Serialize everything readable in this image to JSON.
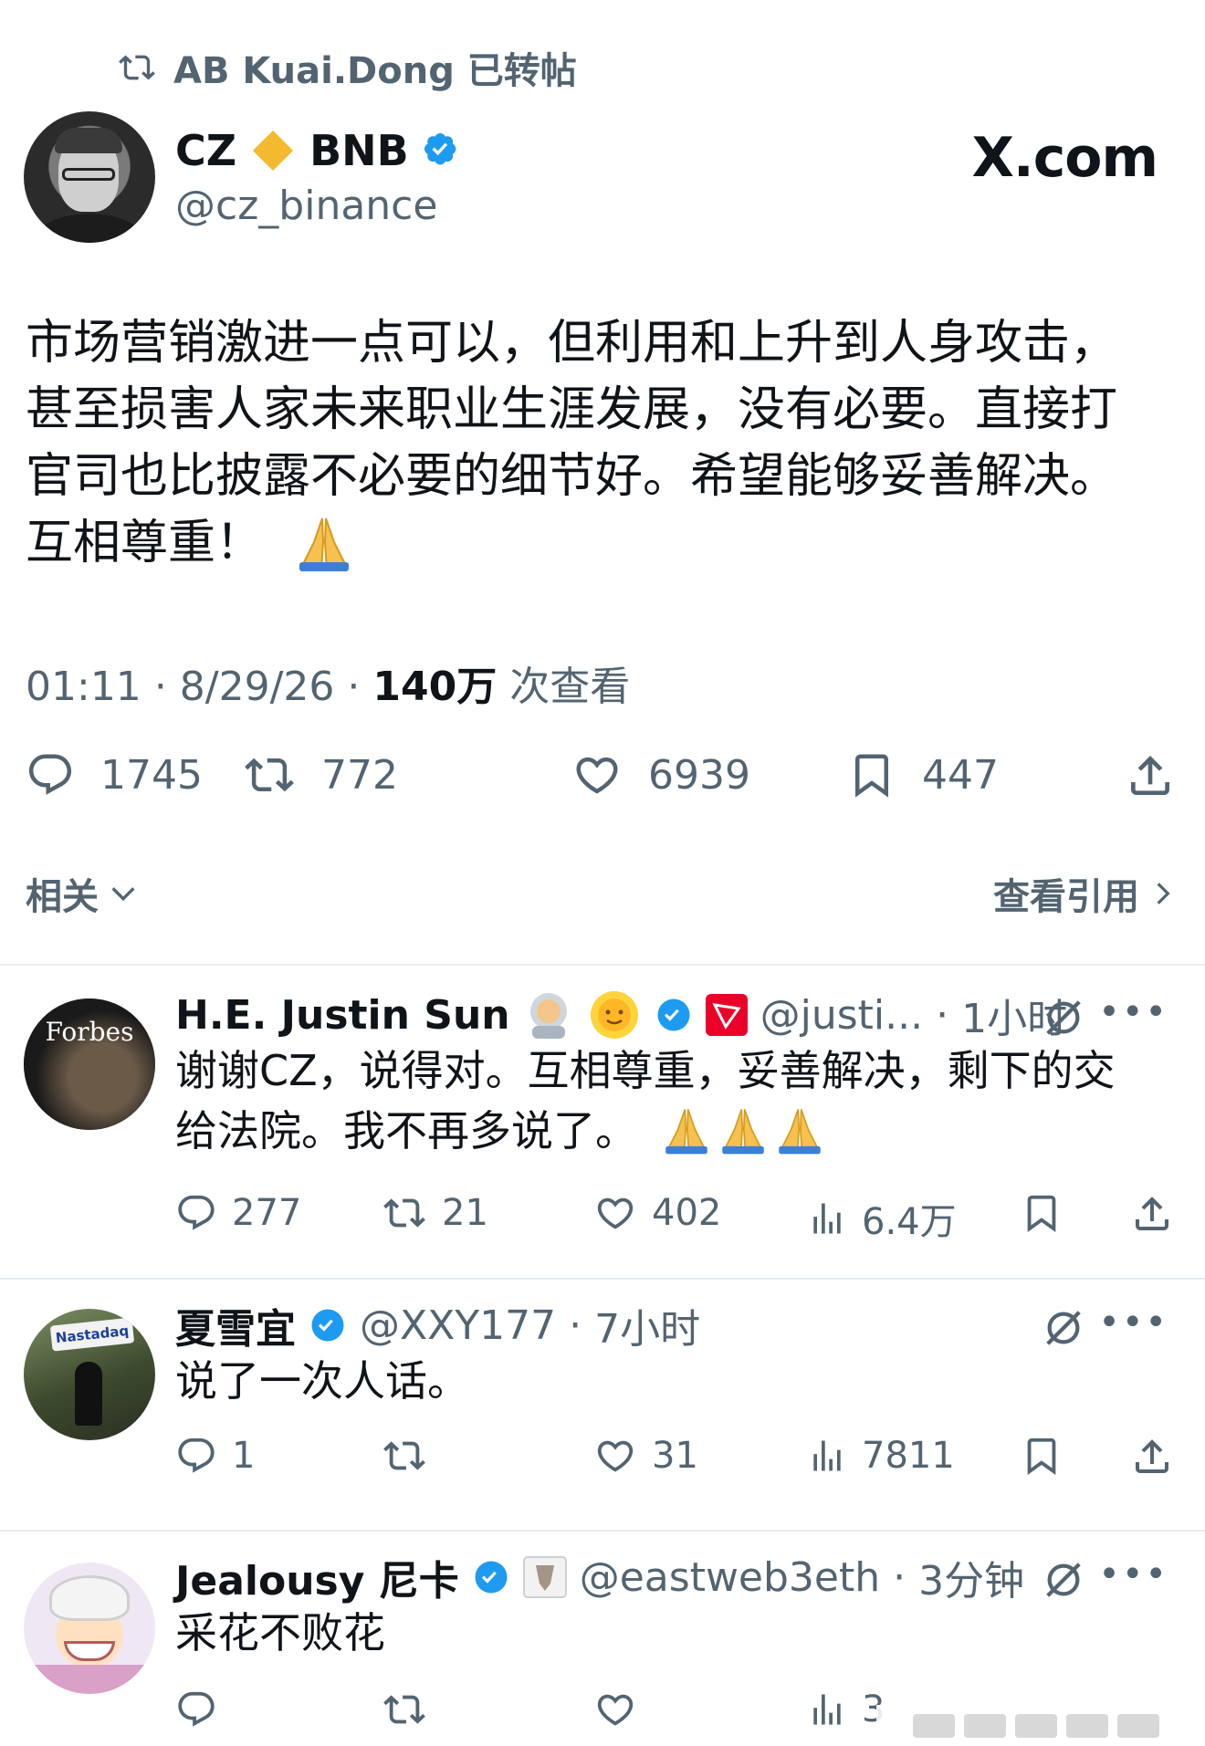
{
  "repost": {
    "text": "AB Kuai.Dong 已转帖"
  },
  "main_post": {
    "author_name": "CZ",
    "author_suffix": "BNB",
    "handle": "@cz_binance",
    "site_logo": "X.com",
    "text_lines": [
      "市场营销激进一点可以，但利用和上升到人身攻击，",
      "甚至损害人家未来职业生涯发展，没有必要。直接打",
      "官司也比披露不必要的细节好。希望能够妥善解决。",
      "互相尊重！"
    ],
    "time": "01:11",
    "date": "8/29/26",
    "views": "140万",
    "views_label": "次查看",
    "replies": "1745",
    "reposts": "772",
    "likes": "6939",
    "bookmarks": "447",
    "icons": [
      "reply-icon",
      "repost-icon",
      "like-icon",
      "bookmark-icon",
      "share-icon"
    ]
  },
  "related": {
    "label": "相关",
    "quotes_label": "查看引用"
  },
  "replies": [
    {
      "name": "H.E. Justin Sun",
      "avatar_text": "Forbes",
      "handle": "@justi...",
      "time": "1小时",
      "text_lines": [
        "谢谢CZ，说得对。互相尊重，妥善解决，剩下的交",
        "给法院。我不再多说了。"
      ],
      "replies": "277",
      "reposts": "21",
      "likes": "402",
      "views": "6.4万"
    },
    {
      "name": "夏雪宜",
      "avatar_text": "Nastadaq",
      "handle": "@XXY177",
      "time": "7小时",
      "text_lines": [
        "说了一次人话。"
      ],
      "replies": "1",
      "reposts": "",
      "likes": "31",
      "views": "7811"
    },
    {
      "name": "Jealousy 尼卡",
      "handle": "@eastweb3eth",
      "time": "3分钟",
      "text_lines": [
        "采花不败花"
      ],
      "replies": "",
      "reposts": "",
      "likes": "",
      "views": "3"
    }
  ],
  "colors": {
    "verified": "#1d9bf0",
    "text": "#0f1419",
    "muted": "#536471",
    "bnb": "#f3ba2f",
    "tron": "#eb0029"
  }
}
